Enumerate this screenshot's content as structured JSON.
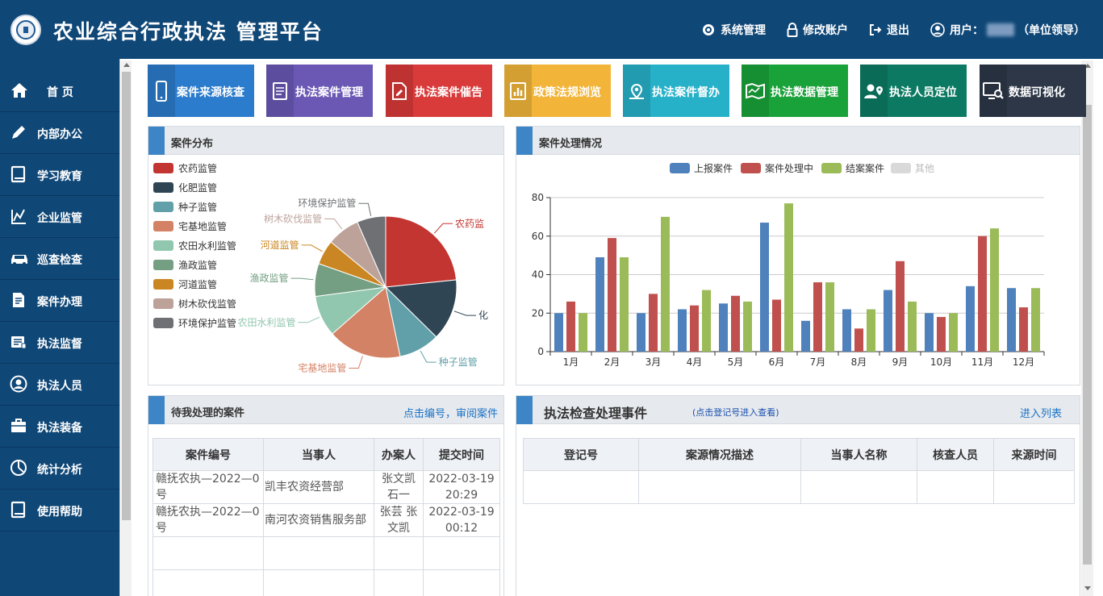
{
  "header": {
    "title": "农业综合行政执法 管理平台",
    "links": [
      {
        "label": "系统管理",
        "icon": "gear-icon"
      },
      {
        "label": "修改账户",
        "icon": "lock-icon"
      },
      {
        "label": "退出",
        "icon": "logout-icon"
      }
    ],
    "user_prefix": "用户：",
    "user_role": "（单位领导）"
  },
  "sidebar": {
    "items": [
      {
        "label": "首 页",
        "icon": "home-icon"
      },
      {
        "label": "内部办公",
        "icon": "pencil-icon"
      },
      {
        "label": "学习教育",
        "icon": "book-icon"
      },
      {
        "label": "企业监管",
        "icon": "chart-icon"
      },
      {
        "label": "巡查检查",
        "icon": "car-icon"
      },
      {
        "label": "案件办理",
        "icon": "document-icon"
      },
      {
        "label": "执法监督",
        "icon": "keyboard-icon"
      },
      {
        "label": "执法人员",
        "icon": "user-icon"
      },
      {
        "label": "执法装备",
        "icon": "briefcase-icon"
      },
      {
        "label": "统计分析",
        "icon": "pie-icon"
      },
      {
        "label": "使用帮助",
        "icon": "help-book-icon"
      }
    ]
  },
  "tiles": [
    {
      "label": "案件来源核查",
      "color": "#2b7ccc",
      "icon": "phone-icon"
    },
    {
      "label": "执法案件管理",
      "color": "#6a58b4",
      "icon": "list-icon"
    },
    {
      "label": "执法案件催告",
      "color": "#d93a3a",
      "icon": "file-edit-icon"
    },
    {
      "label": "政策法规浏览",
      "color": "#f2b53a",
      "icon": "bar-chart-icon"
    },
    {
      "label": "执法案件督办",
      "color": "#27b1c9",
      "icon": "location-icon"
    },
    {
      "label": "执法数据管理",
      "color": "#1aa23a",
      "icon": "map-icon"
    },
    {
      "label": "执法人员定位",
      "color": "#0c7a63",
      "icon": "user-location-icon"
    },
    {
      "label": "数据可视化",
      "color": "#2d3748",
      "icon": "monitor-search-icon"
    }
  ],
  "case_distribution": {
    "title": "案件分布",
    "chart_data": {
      "type": "pie",
      "labels": [
        "农药监管",
        "化肥监管",
        "种子监管",
        "宅基地监管",
        "农田水利监管",
        "渔政监管",
        "河道监管",
        "树木砍伐监管",
        "环境保护监管"
      ],
      "values": [
        25,
        15,
        10,
        18,
        10,
        8,
        6,
        8,
        7
      ],
      "colors": [
        "#c23531",
        "#2f4554",
        "#61a0a8",
        "#d48265",
        "#91c7ae",
        "#749f83",
        "#ca8622",
        "#bda29a",
        "#6e7074"
      ],
      "callout_labels": [
        "农药监",
        "化",
        "种子监管",
        "宅基地监管",
        "农田水利监管",
        "渔政监管",
        "河道监管",
        "树木砍伐监管",
        "环境保护监管"
      ]
    }
  },
  "case_processing": {
    "title": "案件处理情况",
    "chart_data": {
      "type": "bar",
      "categories": [
        "1月",
        "2月",
        "3月",
        "4月",
        "5月",
        "6月",
        "7月",
        "8月",
        "9月",
        "10月",
        "11月",
        "12月"
      ],
      "series": [
        {
          "name": "上报案件",
          "color": "#4f81bd",
          "values": [
            20,
            49,
            20,
            22,
            25,
            67,
            16,
            22,
            32,
            20,
            34,
            33
          ]
        },
        {
          "name": "案件处理中",
          "color": "#c0504d",
          "values": [
            26,
            59,
            30,
            24,
            29,
            27,
            36,
            12,
            47,
            18,
            60,
            23
          ]
        },
        {
          "name": "结案案件",
          "color": "#9bbb59",
          "values": [
            20,
            49,
            70,
            32,
            26,
            77,
            36,
            22,
            26,
            20,
            64,
            33
          ]
        },
        {
          "name": "其他",
          "color": "#d9d9d9",
          "values": []
        }
      ],
      "ylim": [
        0,
        80
      ],
      "yticks": [
        0,
        20,
        40,
        60,
        80
      ],
      "grid": true,
      "legend": "top"
    }
  },
  "pending_cases": {
    "title": "待我处理的案件",
    "link": "点击编号，审阅案件",
    "columns": [
      "案件编号",
      "当事人",
      "办案人",
      "提交时间"
    ],
    "rows": [
      [
        "赣抚农执—2022—0号",
        "凯丰农资经营部",
        "张文凯 石一",
        "2022-03-19 20:29"
      ],
      [
        "赣抚农执—2022—0号",
        "南河农资销售服务部",
        "张芸 张文凯",
        "2022-03-19 00:12"
      ]
    ]
  },
  "inspection_events": {
    "title": "执法检查处理事件",
    "hint": "(点击登记号进入查看)",
    "link": "进入列表",
    "columns": [
      "登记号",
      "案源情况描述",
      "当事人名称",
      "核查人员",
      "来源时间"
    ]
  }
}
